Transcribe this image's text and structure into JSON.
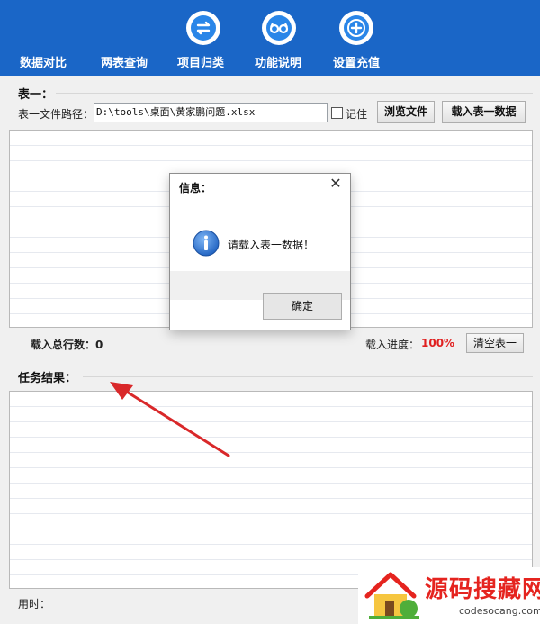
{
  "toolbar": {
    "items": [
      {
        "label": "数据对比",
        "icon": "compare-icon"
      },
      {
        "label": "两表查询",
        "icon": "arrows-exchange-icon"
      },
      {
        "label": "项目归类",
        "icon": "glasses-icon"
      },
      {
        "label": "功能说明",
        "icon": "glasses-icon"
      },
      {
        "label": "设置充值",
        "icon": "plus-icon"
      }
    ]
  },
  "table1": {
    "group_title": "表一：",
    "path_label": "表一文件路径：",
    "path_value": "D:\\tools\\桌面\\黄家鹏问题.xlsx",
    "remember_label": "记住",
    "remember_checked": false,
    "browse_button": "浏览文件",
    "load_button": "载入表一数据",
    "total_rows_label": "载入总行数：0",
    "progress_label": "载入进度：",
    "progress_value": "100%",
    "clear_button": "清空表一"
  },
  "task": {
    "group_title": "任务结果：",
    "time_label": "用时："
  },
  "dialog": {
    "title": "信息：",
    "close_symbol": "✕",
    "message": "请载入表一数据！",
    "ok_button": "确定"
  },
  "watermark": {
    "main": "源码搜藏网",
    "sub": "codesocang.com"
  },
  "colors": {
    "toolbar_bg": "#1a66c7",
    "progress_red": "#e02020",
    "arrow_red": "#d9282a"
  }
}
